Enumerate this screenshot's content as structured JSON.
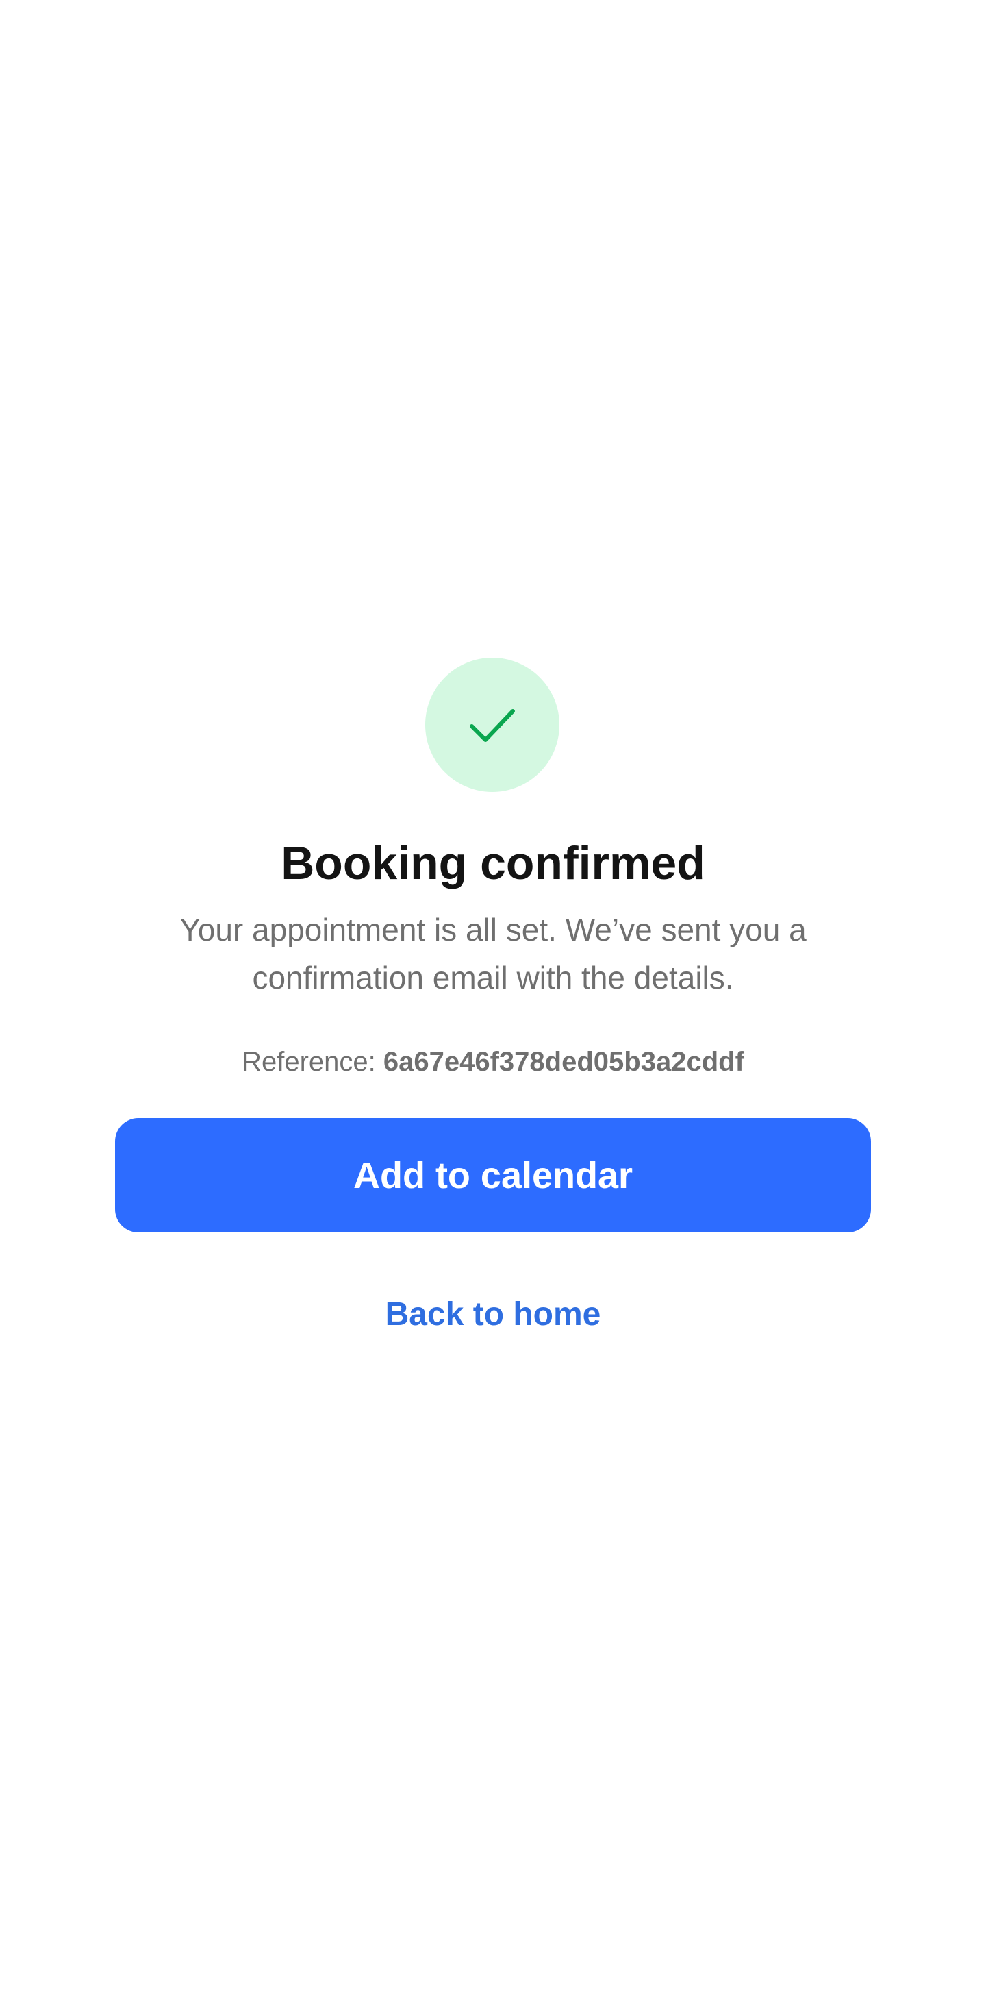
{
  "confirmation": {
    "icon": "checkmark-icon",
    "title": "Booking confirmed",
    "message": "Your appointment is all set. We’ve sent you a confirmation email with the details.",
    "reference_label": "Reference:",
    "reference_value": "6a67e46f378ded05b3a2cddf"
  },
  "actions": {
    "primary_label": "Add to calendar",
    "secondary_label": "Back to home"
  },
  "colors": {
    "primary": "#2d6cff",
    "link": "#2f6ee0",
    "success_bg": "#d4f8e1",
    "success_check": "#0aa64f",
    "title_text": "#141414",
    "muted_text": "#6f6f6f"
  }
}
